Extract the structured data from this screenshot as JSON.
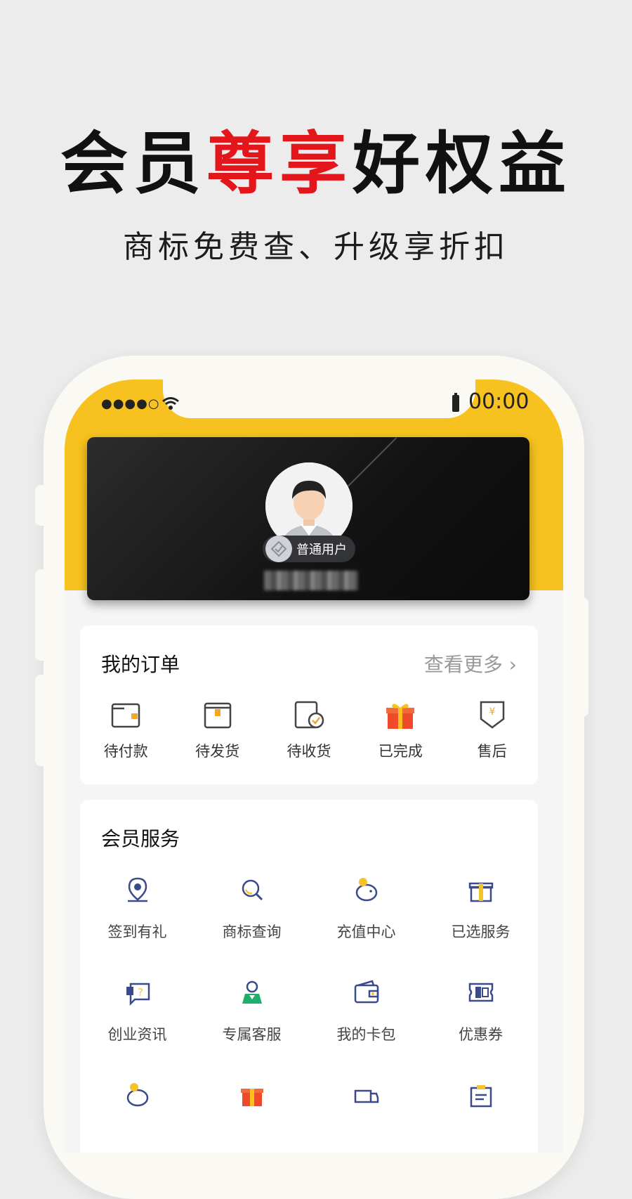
{
  "headline": {
    "part1": "会员",
    "part2": "尊享",
    "part3": "好权益"
  },
  "subline": "商标免费查、升级享折扣",
  "status_bar": {
    "signal": "●●●●○",
    "time": "00:00"
  },
  "profile": {
    "badge": "普通用户"
  },
  "orders": {
    "title": "我的订单",
    "more": "查看更多",
    "items": [
      {
        "label": "待付款",
        "icon": "wallet-icon"
      },
      {
        "label": "待发货",
        "icon": "package-icon"
      },
      {
        "label": "待收货",
        "icon": "received-icon"
      },
      {
        "label": "已完成",
        "icon": "gift-icon"
      },
      {
        "label": "售后",
        "icon": "shield-yen-icon"
      }
    ]
  },
  "services": {
    "title": "会员服务",
    "items": [
      {
        "label": "签到有礼",
        "icon": "location-pin-icon"
      },
      {
        "label": "商标查询",
        "icon": "search-icon"
      },
      {
        "label": "充值中心",
        "icon": "piggy-bank-icon"
      },
      {
        "label": "已选服务",
        "icon": "gift-box-icon"
      },
      {
        "label": "创业资讯",
        "icon": "message-icon"
      },
      {
        "label": "专属客服",
        "icon": "customer-service-icon"
      },
      {
        "label": "我的卡包",
        "icon": "card-wallet-icon"
      },
      {
        "label": "优惠券",
        "icon": "coupon-icon"
      }
    ]
  },
  "colors": {
    "accent": "#f7c21f",
    "red": "#e3161b",
    "icon_blue": "#3b4a8a",
    "icon_yellow": "#f5c32c",
    "icon_green": "#1fae6b"
  }
}
